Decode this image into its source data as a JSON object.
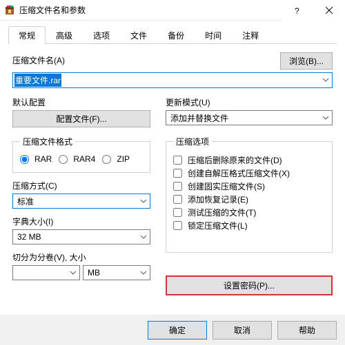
{
  "window": {
    "title": "压缩文件名和参数"
  },
  "tabs": [
    "常规",
    "高级",
    "选项",
    "文件",
    "备份",
    "时间",
    "注释"
  ],
  "filename": {
    "label": "压缩文件名(A)",
    "value": "重要文件.rar",
    "browse": "浏览(B)..."
  },
  "default_config": {
    "label": "默认配置",
    "button": "配置文件(F)..."
  },
  "update_mode": {
    "label": "更新模式(U)",
    "value": "添加并替换文件"
  },
  "format": {
    "legend": "压缩文件格式",
    "options": [
      "RAR",
      "RAR4",
      "ZIP"
    ]
  },
  "method": {
    "label": "压缩方式(C)",
    "value": "标准"
  },
  "dict": {
    "label": "字典大小(I)",
    "value": "32 MB"
  },
  "split": {
    "label": "切分为分卷(V), 大小",
    "unit": "MB"
  },
  "options": {
    "legend": "压缩选项",
    "items": [
      "压缩后删除原来的文件(D)",
      "创建自解压格式压缩文件(X)",
      "创建固实压缩文件(S)",
      "添加恢复记录(E)",
      "测试压缩的文件(T)",
      "锁定压缩文件(L)"
    ]
  },
  "password_button": "设置密码(P)...",
  "buttons": {
    "ok": "确定",
    "cancel": "取消",
    "help": "帮助"
  }
}
